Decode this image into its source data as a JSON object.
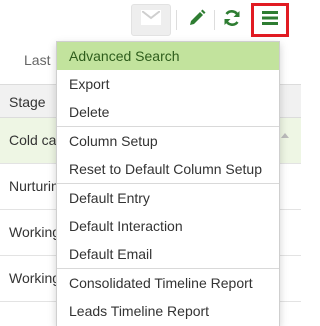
{
  "toolbar": {
    "icons": [
      "mail-icon",
      "pencil-icon",
      "refresh-icon",
      "menu-icon"
    ],
    "colors": {
      "green": "#2e7d32",
      "highlight_border": "#e11b22"
    }
  },
  "filter": {
    "last_label": "Last"
  },
  "table": {
    "header": "Stage",
    "rows": [
      "Cold ca",
      "Nurturin",
      "Working",
      "Working"
    ]
  },
  "menu": {
    "items": [
      "Advanced Search",
      "Export",
      "Delete",
      "Column Setup",
      "Reset to Default Column Setup",
      "Default Entry",
      "Default Interaction",
      "Default Email",
      "Consolidated Timeline Report",
      "Leads Timeline Report"
    ],
    "active_color": "#c2e39d"
  }
}
